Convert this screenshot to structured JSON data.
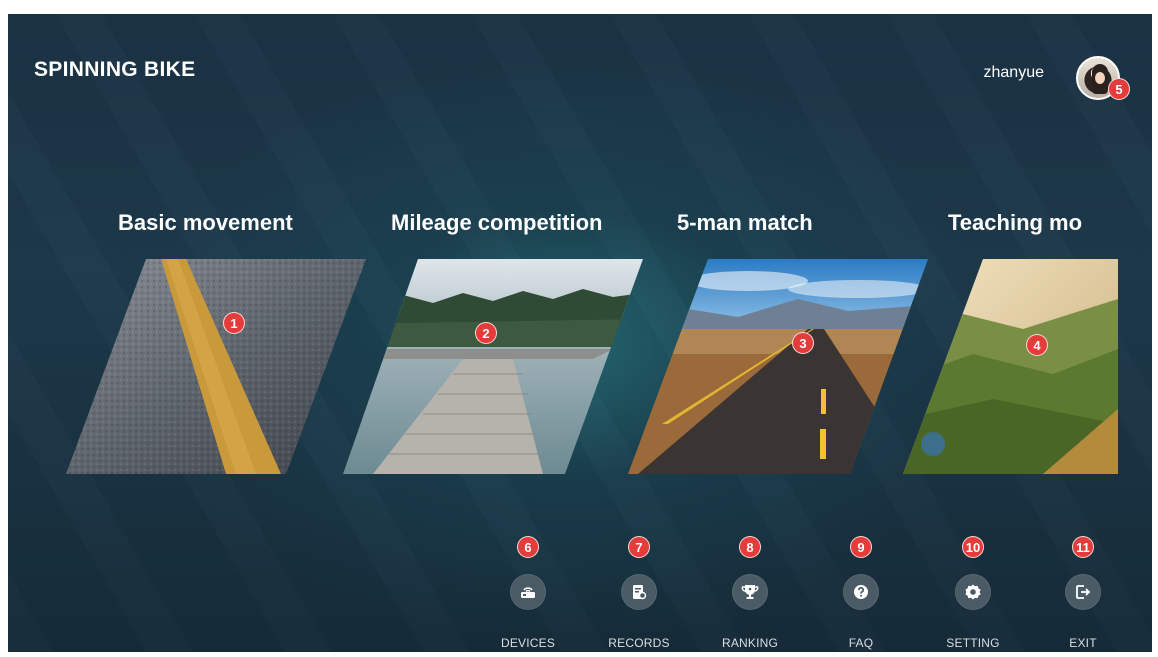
{
  "app": {
    "title": "SPINNING BIKE"
  },
  "user": {
    "name": "zhanyue",
    "badge": "5"
  },
  "cards": [
    {
      "title": "Basic movement",
      "badge": "1",
      "image": "asphalt-road-line"
    },
    {
      "title": "Mileage competition",
      "badge": "2",
      "image": "lake-pier-forest"
    },
    {
      "title": "5-man match",
      "badge": "3",
      "image": "desert-highway-mountains"
    },
    {
      "title": "Teaching mo",
      "badge": "4",
      "image": "green-mountain-valley"
    }
  ],
  "nav": [
    {
      "label": "DEVICES",
      "badge": "6",
      "icon": "router-icon"
    },
    {
      "label": "RECORDS",
      "badge": "7",
      "icon": "document-search-icon"
    },
    {
      "label": "RANKING",
      "badge": "8",
      "icon": "trophy-icon"
    },
    {
      "label": "FAQ",
      "badge": "9",
      "icon": "question-icon"
    },
    {
      "label": "SETTING",
      "badge": "10",
      "icon": "gear-icon"
    },
    {
      "label": "EXIT",
      "badge": "11",
      "icon": "exit-icon"
    }
  ],
  "colors": {
    "badge": "#e43b3b",
    "background": "#1b3344",
    "icon_circle": "#4b5b66"
  }
}
